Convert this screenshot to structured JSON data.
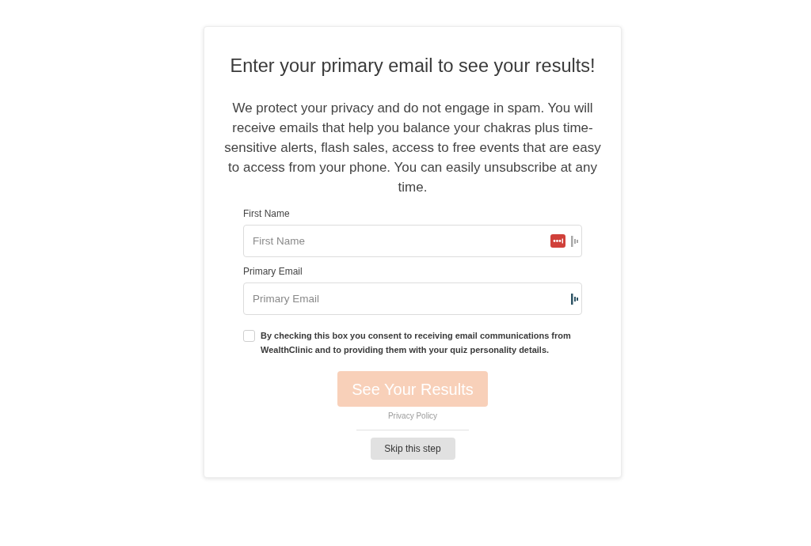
{
  "card": {
    "title": "Enter your primary email to see your results!",
    "intro": "We protect your privacy and do not engage in spam. You will receive emails that help you balance your chakras plus time-sensitive alerts, flash sales, access to free events that are easy to access from your phone. You can easily unsubscribe at any time.",
    "fields": [
      {
        "label": "First Name",
        "placeholder": "First Name",
        "icons": [
          {
            "kind": "dots"
          },
          {
            "kind": "bars",
            "active": false
          }
        ]
      },
      {
        "label": "Primary Email",
        "placeholder": "Primary Email",
        "icons": [
          {
            "kind": "bars",
            "active": true
          }
        ]
      }
    ],
    "consent": {
      "text": "By checking this box you consent to receiving email communications from WealthClinic and to providing them with your quiz personality details.",
      "checked": false
    },
    "submit": {
      "label": "See Your Results",
      "disabled": true
    },
    "privacy_link": "Privacy Policy",
    "skip_button": "Skip this step"
  }
}
